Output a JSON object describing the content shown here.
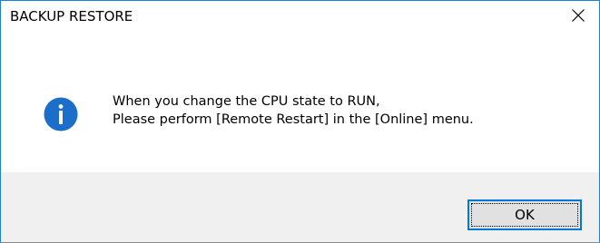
{
  "window": {
    "title": "BACKUP RESTORE",
    "accent_color": "#0078d7"
  },
  "titlebar": {
    "close_icon": "close-icon"
  },
  "dialog": {
    "icon": "info-icon",
    "icon_color": "#1b6fc8",
    "message_line1": "When you change the CPU state to RUN,",
    "message_line2": "Please perform [Remote Restart] in the [Online] menu."
  },
  "buttons": {
    "ok_label": "OK"
  }
}
